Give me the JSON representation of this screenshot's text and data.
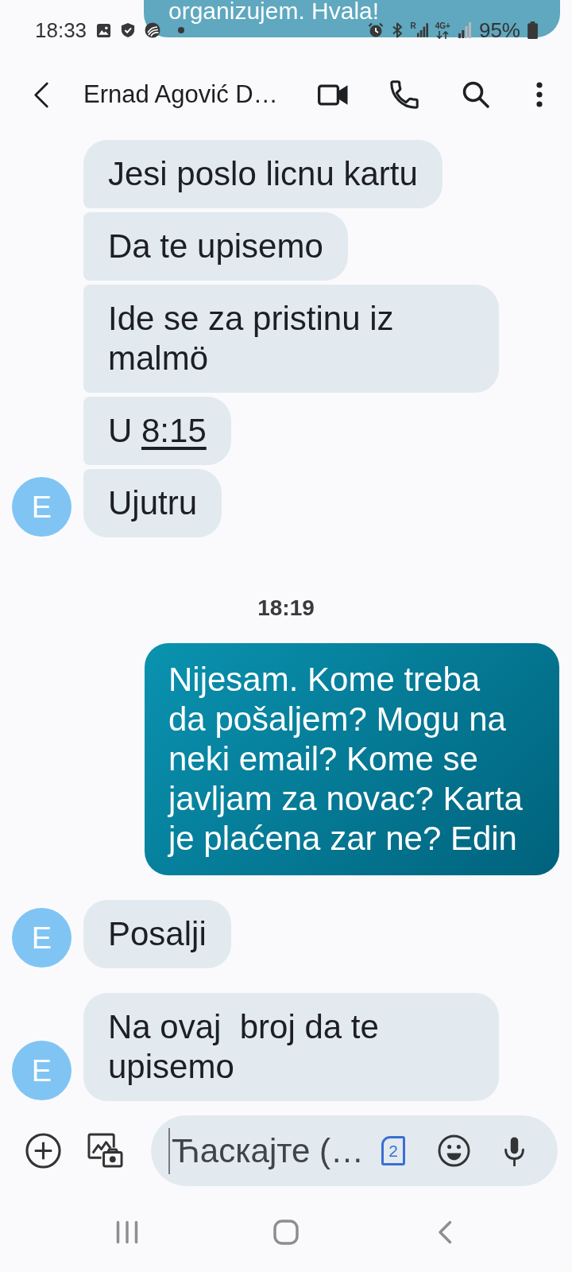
{
  "status_bar": {
    "time": "18:33",
    "roaming": "R",
    "network": "4G+",
    "battery": "95%"
  },
  "clipped_message": {
    "text": "organizujem. Hvala!"
  },
  "header": {
    "title": "Ernad Agović D…"
  },
  "conversation": [
    {
      "kind": "received_group",
      "avatar": "E",
      "bubbles": [
        {
          "text": "Jesi poslo licnu kartu"
        },
        {
          "text": "Da te upisemo"
        },
        {
          "text": "Ide se za pristinu iz malmö"
        },
        {
          "text": "U ",
          "link": "8:15"
        },
        {
          "text": "Ujutru"
        }
      ]
    },
    {
      "kind": "timestamp",
      "text": "18:19"
    },
    {
      "kind": "sent",
      "text": "Nijesam. Kome treba da pošaljem? Mogu na neki email? Kome se javljam za novac? Karta je plaćena zar ne? Edin"
    },
    {
      "kind": "received_group",
      "avatar": "E",
      "bubbles": [
        {
          "text": "Posalji"
        }
      ]
    },
    {
      "kind": "received_group",
      "avatar": "E",
      "bubbles": [
        {
          "text": "Na ovaj  broj da te upisemo"
        }
      ]
    }
  ],
  "composer": {
    "placeholder": "Ћаскајте (…",
    "sim": "2"
  }
}
